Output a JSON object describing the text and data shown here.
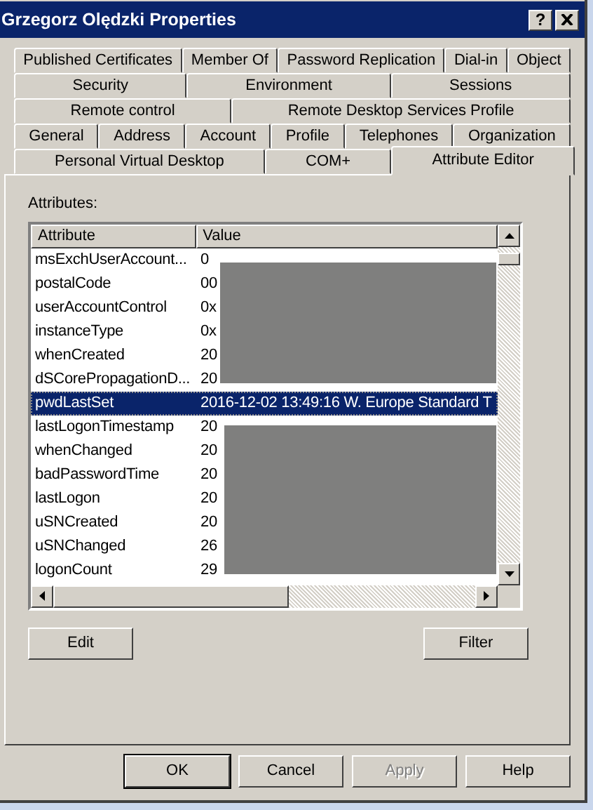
{
  "window": {
    "title": "Grzegorz Olędzki Properties",
    "help_glyph": "?"
  },
  "tab_rows": [
    [
      {
        "label": "Published Certificates",
        "selected": false
      },
      {
        "label": "Member Of",
        "selected": false
      },
      {
        "label": "Password Replication",
        "selected": false
      },
      {
        "label": "Dial-in",
        "selected": false
      },
      {
        "label": "Object",
        "selected": false
      }
    ],
    [
      {
        "label": "Security",
        "selected": false
      },
      {
        "label": "Environment",
        "selected": false
      },
      {
        "label": "Sessions",
        "selected": false
      }
    ],
    [
      {
        "label": "Remote control",
        "selected": false
      },
      {
        "label": "Remote Desktop Services Profile",
        "selected": false
      }
    ],
    [
      {
        "label": "General",
        "selected": false
      },
      {
        "label": "Address",
        "selected": false
      },
      {
        "label": "Account",
        "selected": false
      },
      {
        "label": "Profile",
        "selected": false
      },
      {
        "label": "Telephones",
        "selected": false
      },
      {
        "label": "Organization",
        "selected": false
      }
    ],
    [
      {
        "label": "Personal Virtual Desktop",
        "selected": false
      },
      {
        "label": "COM+",
        "selected": false
      },
      {
        "label": "Attribute Editor",
        "selected": true
      }
    ]
  ],
  "attributes_label": "Attributes:",
  "table": {
    "columns": [
      "Attribute",
      "Value"
    ],
    "rows": [
      {
        "attribute": "msExchUserAccount...",
        "value": "0",
        "selected": false
      },
      {
        "attribute": "postalCode",
        "value": "00",
        "selected": false
      },
      {
        "attribute": "userAccountControl",
        "value": "0x",
        "selected": false
      },
      {
        "attribute": "instanceType",
        "value": "0x",
        "selected": false
      },
      {
        "attribute": "whenCreated",
        "value": "20",
        "selected": false
      },
      {
        "attribute": "dSCorePropagationD...",
        "value": "20",
        "selected": false
      },
      {
        "attribute": "pwdLastSet",
        "value": "2016-12-02 13:49:16 W. Europe Standard T",
        "selected": true
      },
      {
        "attribute": "lastLogonTimestamp",
        "value": "20",
        "selected": false
      },
      {
        "attribute": "whenChanged",
        "value": "20",
        "selected": false
      },
      {
        "attribute": "badPasswordTime",
        "value": "20",
        "selected": false
      },
      {
        "attribute": "lastLogon",
        "value": "20",
        "selected": false
      },
      {
        "attribute": "uSNCreated",
        "value": "20",
        "selected": false
      },
      {
        "attribute": "uSNChanged",
        "value": "26",
        "selected": false
      },
      {
        "attribute": "logonCount",
        "value": "29",
        "selected": false
      }
    ]
  },
  "panel_buttons": [
    {
      "label": "Edit",
      "disabled": false
    },
    {
      "label": "Filter",
      "disabled": false
    }
  ],
  "dialog_buttons": [
    {
      "label": "OK",
      "disabled": false,
      "default": true
    },
    {
      "label": "Cancel",
      "disabled": false,
      "default": false
    },
    {
      "label": "Apply",
      "disabled": true,
      "default": false
    },
    {
      "label": "Help",
      "disabled": false,
      "default": false
    }
  ]
}
